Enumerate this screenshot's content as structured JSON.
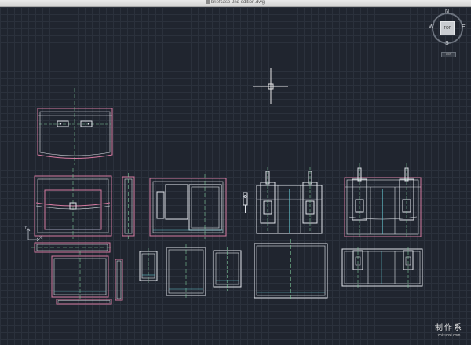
{
  "window": {
    "title": "briefcase 2nd edition.dwg"
  },
  "viewcube": {
    "face_label": "TOP",
    "north": "N",
    "south": "S",
    "east": "E",
    "west": "W",
    "wcs_label": "WCS"
  },
  "ucs_icon": {
    "y_label": "Y",
    "x_label": "X"
  },
  "watermark": {
    "main": "制作系",
    "sub": "zhizuoxi.com"
  },
  "colors": {
    "canvas": "#20252f",
    "grid": "#2b313c",
    "outline_pink": "#d67aa0",
    "outline_white": "#e0e4ea",
    "line_green": "#7ec89a",
    "line_cyan": "#66c6d0"
  }
}
